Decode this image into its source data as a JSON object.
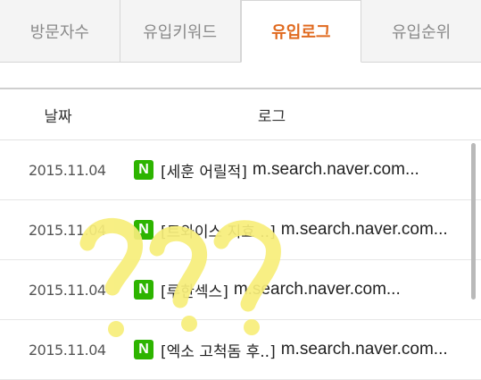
{
  "tabs": [
    {
      "label": "방문자수",
      "active": false
    },
    {
      "label": "유입키워드",
      "active": false
    },
    {
      "label": "유입로그",
      "active": true
    },
    {
      "label": "유입순위",
      "active": false
    }
  ],
  "table": {
    "headers": {
      "date": "날짜",
      "log": "로그"
    },
    "rows": [
      {
        "date": "2015.11.04",
        "keyword": "[세훈 어릴적]",
        "url": "m.search.naver.com..."
      },
      {
        "date": "2015.11.04",
        "keyword": "[트와이스 지효 ..]",
        "url": "m.search.naver.com..."
      },
      {
        "date": "2015.11.04",
        "keyword": "[루한섹스]",
        "url": "m.search.naver.com..."
      },
      {
        "date": "2015.11.04",
        "keyword": "[엑소 고척돔 후..]",
        "url": "m.search.naver.com..."
      }
    ],
    "source_icon_letter": "N"
  },
  "overlay_text": "???",
  "colors": {
    "active_tab": "#e06a1f",
    "naver_green": "#2db400",
    "overlay_yellow": "#f7ee7a"
  }
}
